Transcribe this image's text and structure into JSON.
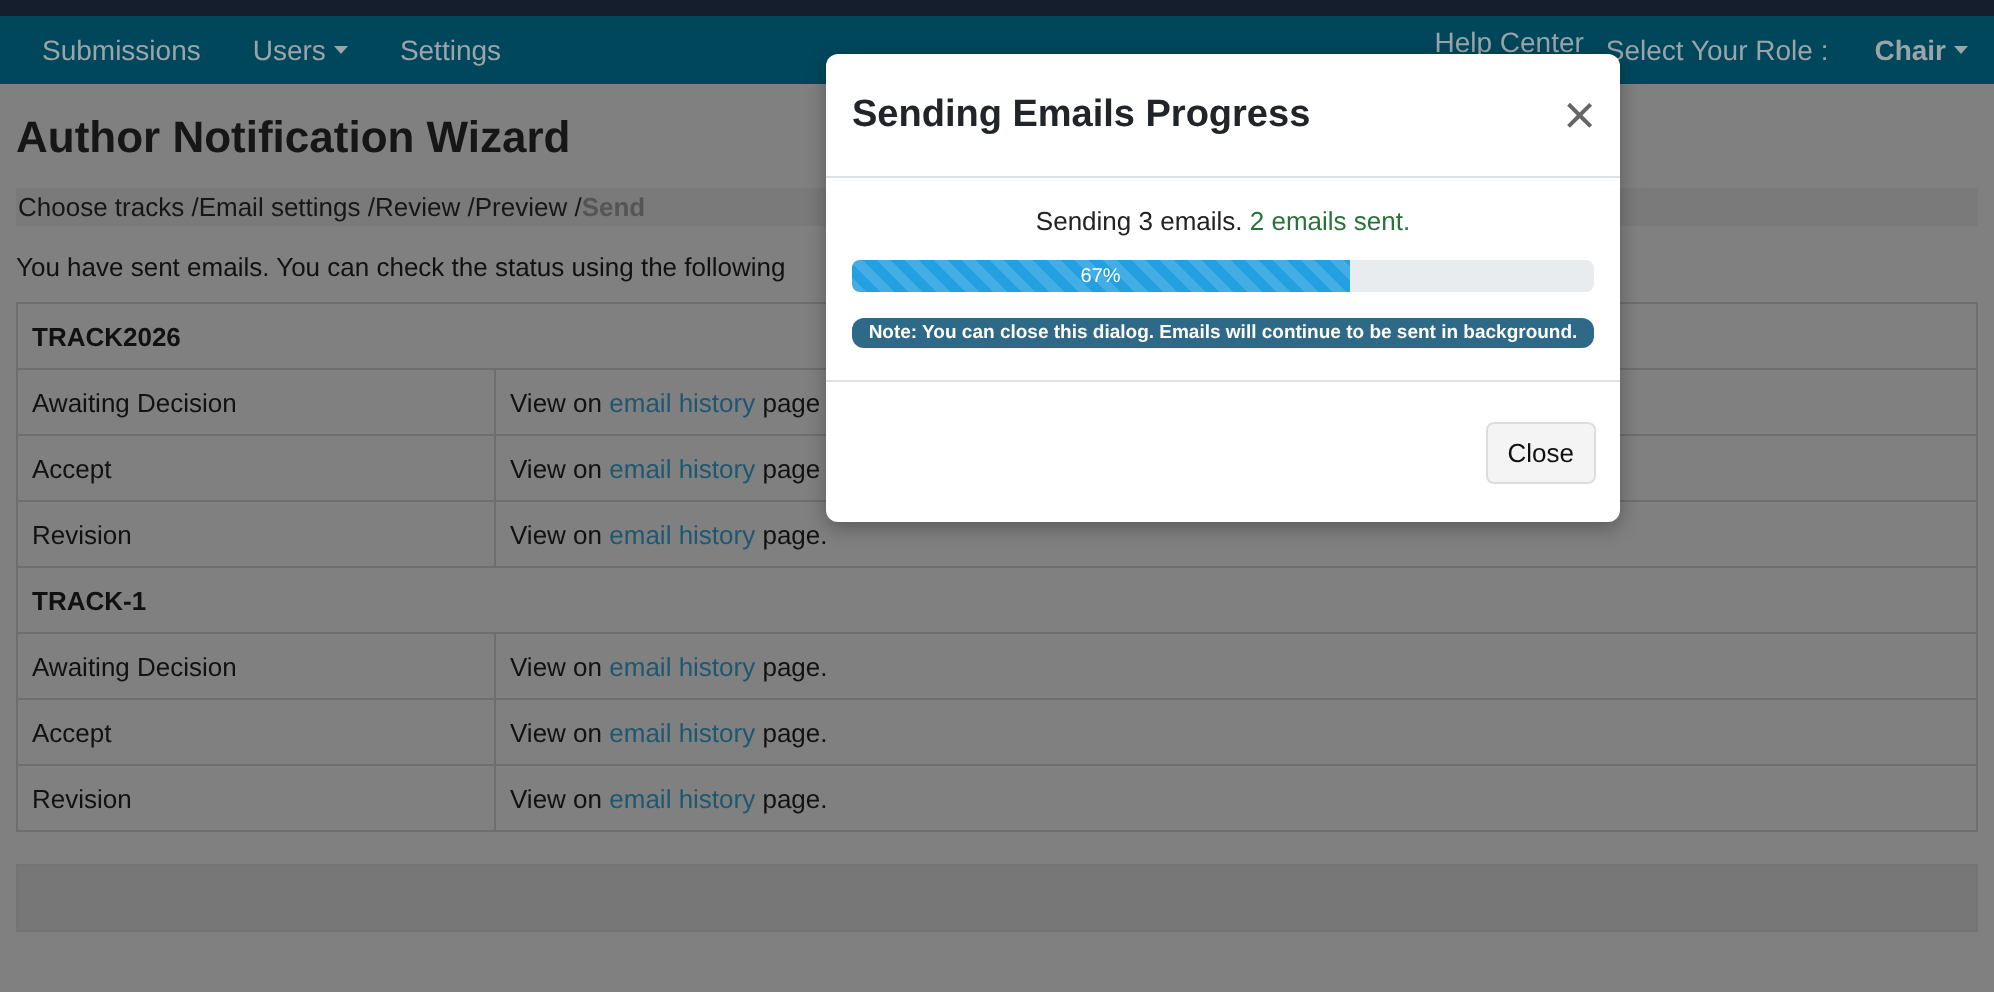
{
  "navbar": {
    "items": [
      {
        "label": "Submissions",
        "dropdown": false
      },
      {
        "label": "Users",
        "dropdown": true
      },
      {
        "label": "Settings",
        "dropdown": false
      }
    ],
    "help": "Help Center",
    "role_label": "Select Your Role :",
    "role": "Chair"
  },
  "page": {
    "title": "Author Notification Wizard",
    "steps": [
      {
        "label": "Choose tracks /",
        "selected": false
      },
      {
        "label": "Email settings /",
        "selected": false
      },
      {
        "label": "Review /",
        "selected": false
      },
      {
        "label": "Preview /",
        "selected": false
      },
      {
        "label": "Send",
        "selected": true
      }
    ],
    "intro": "You have sent emails. You can check the status using the following",
    "tracks": [
      {
        "name": "TRACK2026",
        "rows": [
          {
            "decision": "Awaiting Decision",
            "before": "View on",
            "link": "email history",
            "after": "page"
          },
          {
            "decision": "Accept",
            "before": "View on",
            "link": "email history",
            "after": "page"
          },
          {
            "decision": "Revision",
            "before": "View on",
            "link": "email history",
            "after": "page."
          }
        ]
      },
      {
        "name": "TRACK-1",
        "rows": [
          {
            "decision": "Awaiting Decision",
            "before": "View on",
            "link": "email history",
            "after": "page."
          },
          {
            "decision": "Accept",
            "before": "View on",
            "link": "email history",
            "after": "page."
          },
          {
            "decision": "Revision",
            "before": "View on",
            "link": "email history",
            "after": "page."
          }
        ]
      }
    ]
  },
  "dialog": {
    "title": "Sending Emails Progress",
    "close_icon": "×",
    "status": "Sending 3 emails.",
    "sent": "2 emails sent.",
    "progress": {
      "level": 0.67,
      "label": "67%"
    },
    "note": "Note: You can close this dialog. Emails will continue to be sent in background.",
    "button": "Close"
  }
}
